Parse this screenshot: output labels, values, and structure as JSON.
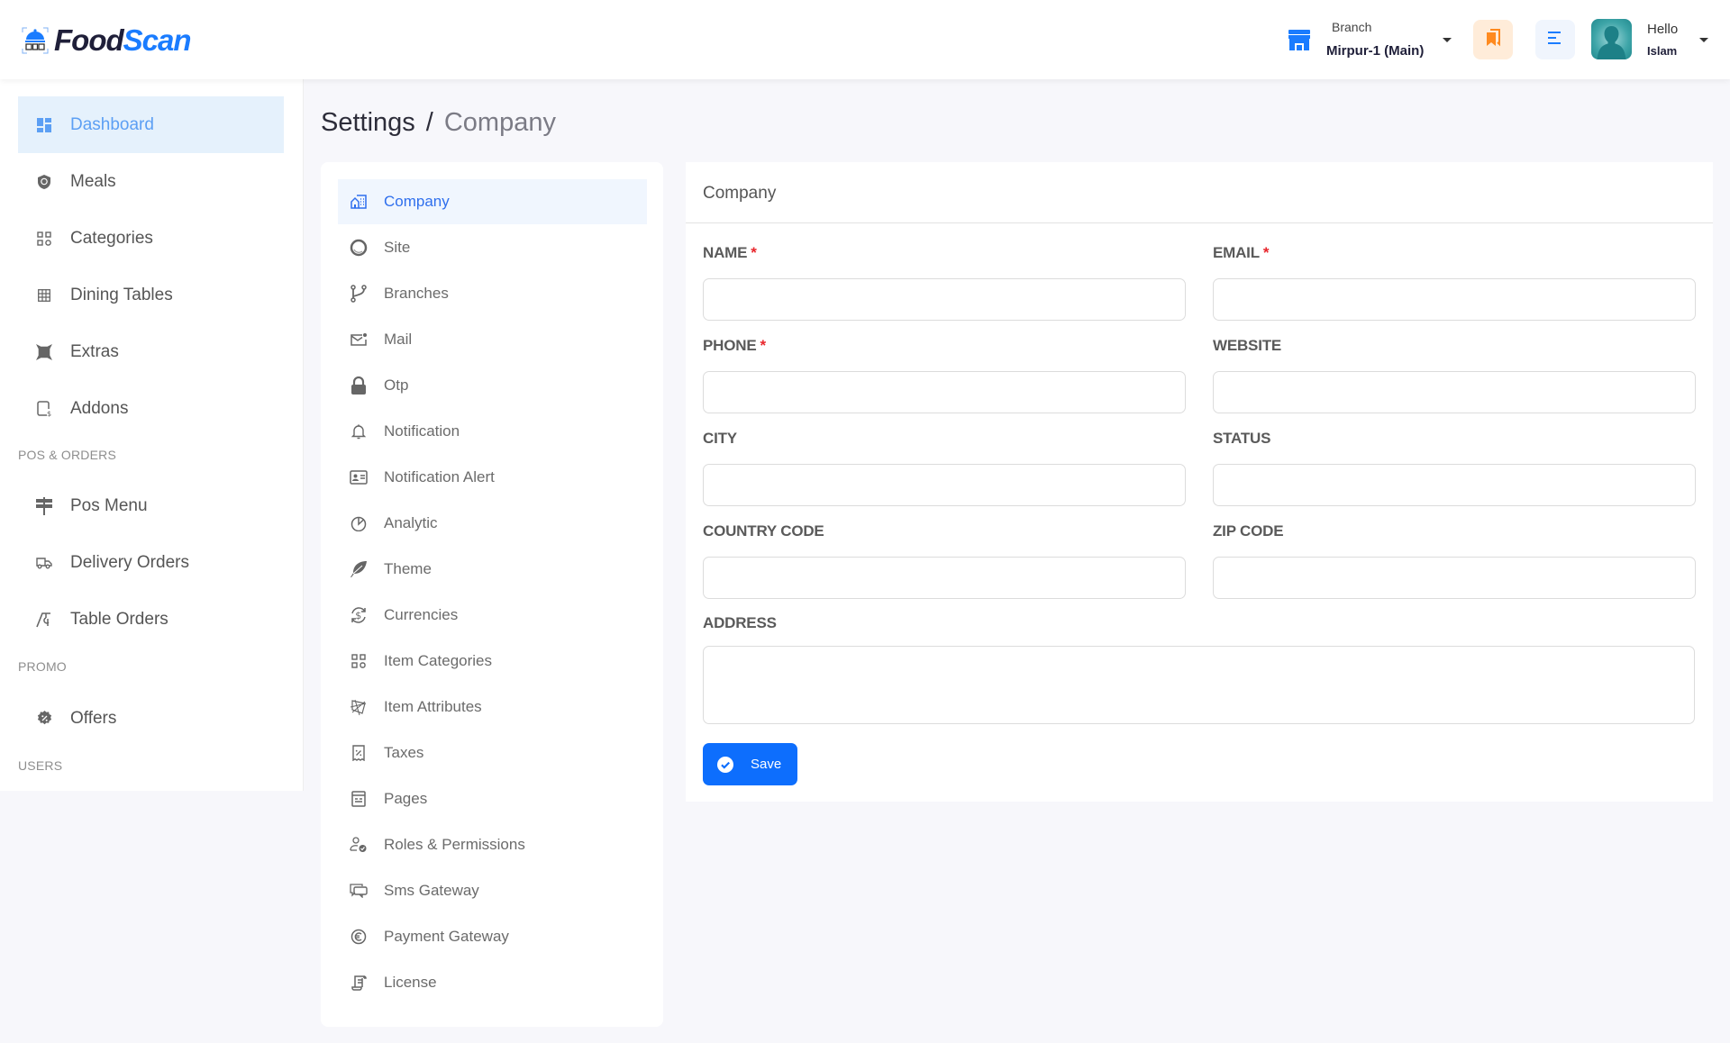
{
  "brand": {
    "name_part1": "Food",
    "name_part2": "Scan",
    "accent_color": "#1a7cff"
  },
  "header": {
    "branch_label": "Branch",
    "branch_value": "Mirpur-1 (Main)",
    "greeting": "Hello",
    "user_name": "Islam",
    "icons": {
      "branch": "store-icon",
      "orders": "bookmark-icon",
      "menu": "menu-lines-icon",
      "avatar": "user-avatar"
    }
  },
  "sidebar": {
    "items": [
      {
        "label": "Dashboard",
        "icon": "dashboard-icon",
        "active": true
      },
      {
        "label": "Meals",
        "icon": "meals-icon"
      },
      {
        "label": "Categories",
        "icon": "categories-icon"
      },
      {
        "label": "Dining Tables",
        "icon": "table-grid-icon"
      },
      {
        "label": "Extras",
        "icon": "extras-icon"
      },
      {
        "label": "Addons",
        "icon": "addons-icon"
      }
    ],
    "sections": [
      {
        "title": "POS & ORDERS",
        "items": [
          {
            "label": "Pos Menu",
            "icon": "signpost-icon"
          },
          {
            "label": "Delivery Orders",
            "icon": "delivery-truck-icon"
          },
          {
            "label": "Table Orders",
            "icon": "table-orders-icon"
          }
        ]
      },
      {
        "title": "PROMO",
        "items": [
          {
            "label": "Offers",
            "icon": "discount-badge-icon"
          }
        ]
      },
      {
        "title": "USERS",
        "items": []
      }
    ]
  },
  "breadcrumb": {
    "root": "Settings",
    "separator": "/",
    "current": "Company"
  },
  "settings_menu": [
    {
      "label": "Company",
      "icon": "company-building-icon",
      "active": true
    },
    {
      "label": "Site",
      "icon": "site-globe-icon"
    },
    {
      "label": "Branches",
      "icon": "branch-fork-icon"
    },
    {
      "label": "Mail",
      "icon": "mail-icon"
    },
    {
      "label": "Otp",
      "icon": "lock-icon"
    },
    {
      "label": "Notification",
      "icon": "bell-icon"
    },
    {
      "label": "Notification Alert",
      "icon": "id-card-icon"
    },
    {
      "label": "Analytic",
      "icon": "pie-chart-icon"
    },
    {
      "label": "Theme",
      "icon": "feather-icon"
    },
    {
      "label": "Currencies",
      "icon": "currency-exchange-icon"
    },
    {
      "label": "Item Categories",
      "icon": "grid-icon"
    },
    {
      "label": "Item Attributes",
      "icon": "attributes-icon"
    },
    {
      "label": "Taxes",
      "icon": "tax-receipt-icon"
    },
    {
      "label": "Pages",
      "icon": "pages-icon"
    },
    {
      "label": "Roles & Permissions",
      "icon": "user-check-icon"
    },
    {
      "label": "Sms Gateway",
      "icon": "chat-bubbles-icon"
    },
    {
      "label": "Payment Gateway",
      "icon": "euro-icon"
    },
    {
      "label": "License",
      "icon": "scroll-icon"
    }
  ],
  "form": {
    "title": "Company",
    "fields": {
      "name": {
        "label": "NAME",
        "required": true,
        "value": ""
      },
      "email": {
        "label": "EMAIL",
        "required": true,
        "value": ""
      },
      "phone": {
        "label": "PHONE",
        "required": true,
        "value": ""
      },
      "website": {
        "label": "WEBSITE",
        "required": false,
        "value": ""
      },
      "city": {
        "label": "CITY",
        "required": false,
        "value": ""
      },
      "status": {
        "label": "STATUS",
        "required": false,
        "value": ""
      },
      "country_code": {
        "label": "COUNTRY CODE",
        "required": false,
        "value": ""
      },
      "zip_code": {
        "label": "ZIP CODE",
        "required": false,
        "value": ""
      },
      "address": {
        "label": "ADDRESS",
        "required": false,
        "value": ""
      }
    },
    "required_mark": "*",
    "save_label": "Save",
    "save_color": "#0d6efd"
  }
}
